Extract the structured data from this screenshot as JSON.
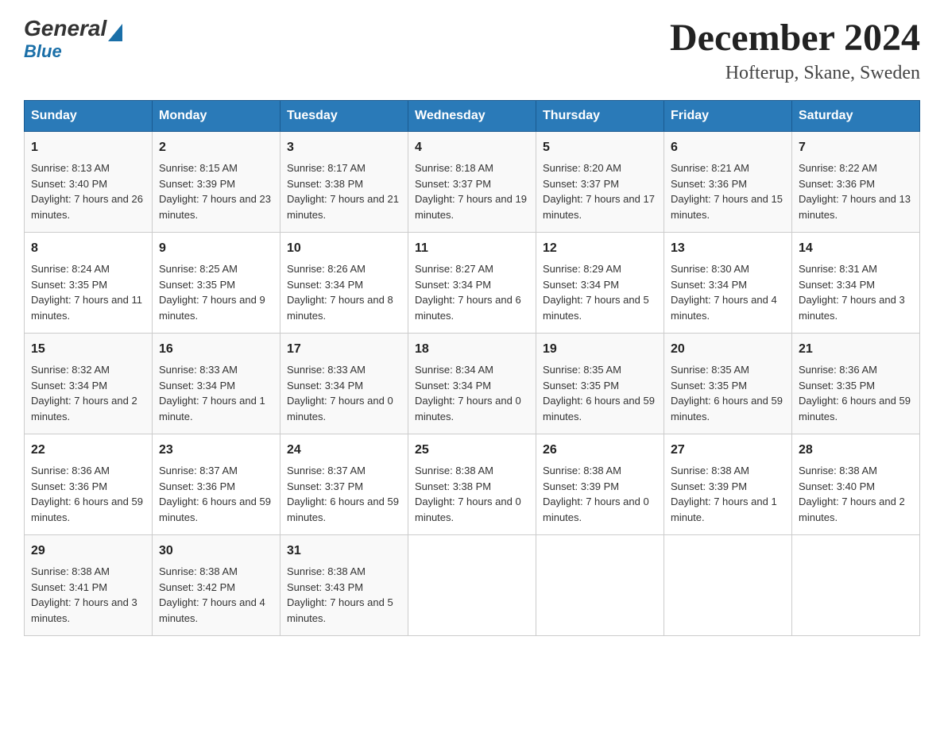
{
  "header": {
    "logo_general": "General",
    "logo_blue": "Blue",
    "month_title": "December 2024",
    "location": "Hofterup, Skane, Sweden"
  },
  "weekdays": [
    "Sunday",
    "Monday",
    "Tuesday",
    "Wednesday",
    "Thursday",
    "Friday",
    "Saturday"
  ],
  "weeks": [
    [
      {
        "day": "1",
        "sunrise": "8:13 AM",
        "sunset": "3:40 PM",
        "daylight": "7 hours and 26 minutes."
      },
      {
        "day": "2",
        "sunrise": "8:15 AM",
        "sunset": "3:39 PM",
        "daylight": "7 hours and 23 minutes."
      },
      {
        "day": "3",
        "sunrise": "8:17 AM",
        "sunset": "3:38 PM",
        "daylight": "7 hours and 21 minutes."
      },
      {
        "day": "4",
        "sunrise": "8:18 AM",
        "sunset": "3:37 PM",
        "daylight": "7 hours and 19 minutes."
      },
      {
        "day": "5",
        "sunrise": "8:20 AM",
        "sunset": "3:37 PM",
        "daylight": "7 hours and 17 minutes."
      },
      {
        "day": "6",
        "sunrise": "8:21 AM",
        "sunset": "3:36 PM",
        "daylight": "7 hours and 15 minutes."
      },
      {
        "day": "7",
        "sunrise": "8:22 AM",
        "sunset": "3:36 PM",
        "daylight": "7 hours and 13 minutes."
      }
    ],
    [
      {
        "day": "8",
        "sunrise": "8:24 AM",
        "sunset": "3:35 PM",
        "daylight": "7 hours and 11 minutes."
      },
      {
        "day": "9",
        "sunrise": "8:25 AM",
        "sunset": "3:35 PM",
        "daylight": "7 hours and 9 minutes."
      },
      {
        "day": "10",
        "sunrise": "8:26 AM",
        "sunset": "3:34 PM",
        "daylight": "7 hours and 8 minutes."
      },
      {
        "day": "11",
        "sunrise": "8:27 AM",
        "sunset": "3:34 PM",
        "daylight": "7 hours and 6 minutes."
      },
      {
        "day": "12",
        "sunrise": "8:29 AM",
        "sunset": "3:34 PM",
        "daylight": "7 hours and 5 minutes."
      },
      {
        "day": "13",
        "sunrise": "8:30 AM",
        "sunset": "3:34 PM",
        "daylight": "7 hours and 4 minutes."
      },
      {
        "day": "14",
        "sunrise": "8:31 AM",
        "sunset": "3:34 PM",
        "daylight": "7 hours and 3 minutes."
      }
    ],
    [
      {
        "day": "15",
        "sunrise": "8:32 AM",
        "sunset": "3:34 PM",
        "daylight": "7 hours and 2 minutes."
      },
      {
        "day": "16",
        "sunrise": "8:33 AM",
        "sunset": "3:34 PM",
        "daylight": "7 hours and 1 minute."
      },
      {
        "day": "17",
        "sunrise": "8:33 AM",
        "sunset": "3:34 PM",
        "daylight": "7 hours and 0 minutes."
      },
      {
        "day": "18",
        "sunrise": "8:34 AM",
        "sunset": "3:34 PM",
        "daylight": "7 hours and 0 minutes."
      },
      {
        "day": "19",
        "sunrise": "8:35 AM",
        "sunset": "3:35 PM",
        "daylight": "6 hours and 59 minutes."
      },
      {
        "day": "20",
        "sunrise": "8:35 AM",
        "sunset": "3:35 PM",
        "daylight": "6 hours and 59 minutes."
      },
      {
        "day": "21",
        "sunrise": "8:36 AM",
        "sunset": "3:35 PM",
        "daylight": "6 hours and 59 minutes."
      }
    ],
    [
      {
        "day": "22",
        "sunrise": "8:36 AM",
        "sunset": "3:36 PM",
        "daylight": "6 hours and 59 minutes."
      },
      {
        "day": "23",
        "sunrise": "8:37 AM",
        "sunset": "3:36 PM",
        "daylight": "6 hours and 59 minutes."
      },
      {
        "day": "24",
        "sunrise": "8:37 AM",
        "sunset": "3:37 PM",
        "daylight": "6 hours and 59 minutes."
      },
      {
        "day": "25",
        "sunrise": "8:38 AM",
        "sunset": "3:38 PM",
        "daylight": "7 hours and 0 minutes."
      },
      {
        "day": "26",
        "sunrise": "8:38 AM",
        "sunset": "3:39 PM",
        "daylight": "7 hours and 0 minutes."
      },
      {
        "day": "27",
        "sunrise": "8:38 AM",
        "sunset": "3:39 PM",
        "daylight": "7 hours and 1 minute."
      },
      {
        "day": "28",
        "sunrise": "8:38 AM",
        "sunset": "3:40 PM",
        "daylight": "7 hours and 2 minutes."
      }
    ],
    [
      {
        "day": "29",
        "sunrise": "8:38 AM",
        "sunset": "3:41 PM",
        "daylight": "7 hours and 3 minutes."
      },
      {
        "day": "30",
        "sunrise": "8:38 AM",
        "sunset": "3:42 PM",
        "daylight": "7 hours and 4 minutes."
      },
      {
        "day": "31",
        "sunrise": "8:38 AM",
        "sunset": "3:43 PM",
        "daylight": "7 hours and 5 minutes."
      },
      null,
      null,
      null,
      null
    ]
  ]
}
